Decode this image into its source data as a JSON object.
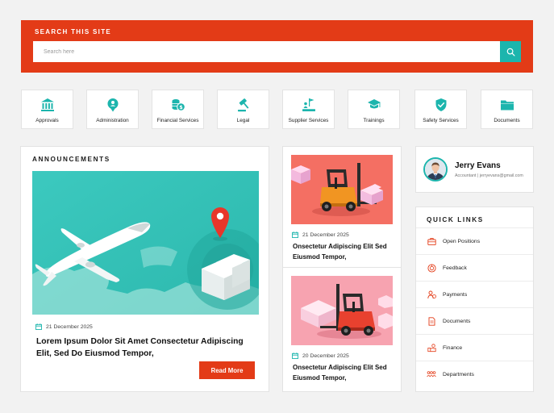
{
  "search": {
    "title": "SEARCH THIS SITE",
    "placeholder": "Search here"
  },
  "tiles": [
    {
      "label": "Approvals",
      "icon": "bank-icon"
    },
    {
      "label": "Administration",
      "icon": "admin-badge-icon"
    },
    {
      "label": "Financial Services",
      "icon": "coins-icon"
    },
    {
      "label": "Legal",
      "icon": "gavel-icon"
    },
    {
      "label": "Supplier Services",
      "icon": "supplier-icon"
    },
    {
      "label": "Trainings",
      "icon": "graduation-cap-icon"
    },
    {
      "label": "Safety Services",
      "icon": "shield-check-icon"
    },
    {
      "label": "Documents",
      "icon": "folder-icon"
    }
  ],
  "announcements": {
    "title": "ANNOUNCEMENTS",
    "date": "21 December 2025",
    "headline": "Lorem Ipsum Dolor Sit Amet Consectetur Adipiscing Elit, Sed Do Eiusmod Tempor,",
    "button": "Read More"
  },
  "news": [
    {
      "date": "21 December 2025",
      "headline": "Onsectetur Adipiscing Elit Sed Eiusmod Tempor,"
    },
    {
      "date": "20 December 2025",
      "headline": "Onsectetur Adipiscing Elit Sed Eiusmod Tempor,"
    }
  ],
  "profile": {
    "name": "Jerry Evans",
    "role": "Accountant | jerryevans@gmail.com"
  },
  "quick_links": {
    "title": "QUICK LINKS",
    "items": [
      {
        "label": "Open Positions",
        "icon": "briefcase-icon"
      },
      {
        "label": "Feedback",
        "icon": "feedback-icon"
      },
      {
        "label": "Payments",
        "icon": "payments-icon"
      },
      {
        "label": "Documents",
        "icon": "document-icon"
      },
      {
        "label": "Finance",
        "icon": "finance-icon"
      },
      {
        "label": "Departments",
        "icon": "departments-icon"
      }
    ]
  },
  "colors": {
    "accent": "#e33b17",
    "teal": "#1cb5ad",
    "background": "#f2f2f2"
  }
}
